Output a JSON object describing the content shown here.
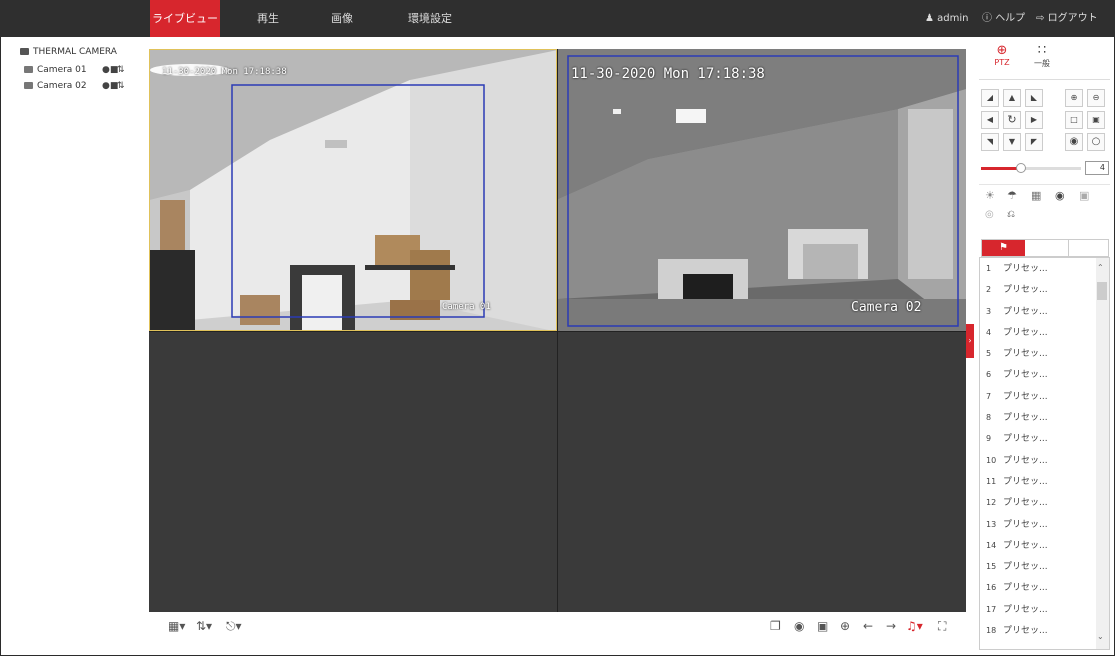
{
  "nav": {
    "tabs": [
      {
        "label": "ライブビュー",
        "active": true
      },
      {
        "label": "再生",
        "active": false
      },
      {
        "label": "画像",
        "active": false
      },
      {
        "label": "環境設定",
        "active": false
      }
    ],
    "user": "admin",
    "help": "ヘルプ",
    "logout": "ログアウト"
  },
  "tree": {
    "root": "THERMAL CAMERA",
    "cameras": [
      "Camera 01",
      "Camera 02"
    ]
  },
  "videos": {
    "cam1": {
      "timestamp": "11-30-2020 Mon 17:18:38",
      "name": "Camera 01"
    },
    "cam2": {
      "timestamp": "11-30-2020 Mon 17:18:38",
      "name": "Camera 02"
    }
  },
  "ptz": {
    "tab_ptz": "PTZ",
    "tab_general": "一般",
    "speed_value": "4",
    "speed_level": 0.4,
    "presets": [
      {
        "num": "1",
        "label": "プリセッ..."
      },
      {
        "num": "2",
        "label": "プリセッ..."
      },
      {
        "num": "3",
        "label": "プリセッ..."
      },
      {
        "num": "4",
        "label": "プリセッ..."
      },
      {
        "num": "5",
        "label": "プリセッ..."
      },
      {
        "num": "6",
        "label": "プリセッ..."
      },
      {
        "num": "7",
        "label": "プリセッ..."
      },
      {
        "num": "8",
        "label": "プリセッ..."
      },
      {
        "num": "9",
        "label": "プリセッ..."
      },
      {
        "num": "10",
        "label": "プリセッ..."
      },
      {
        "num": "11",
        "label": "プリセッ..."
      },
      {
        "num": "12",
        "label": "プリセッ..."
      },
      {
        "num": "13",
        "label": "プリセッ..."
      },
      {
        "num": "14",
        "label": "プリセッ..."
      },
      {
        "num": "15",
        "label": "プリセッ..."
      },
      {
        "num": "16",
        "label": "プリセッ..."
      },
      {
        "num": "17",
        "label": "プリセッ..."
      },
      {
        "num": "18",
        "label": "プリセッ..."
      }
    ]
  },
  "colors": {
    "accent": "#d7262d",
    "topbar": "#2f2f2f",
    "roi": "#2b3bb5"
  }
}
